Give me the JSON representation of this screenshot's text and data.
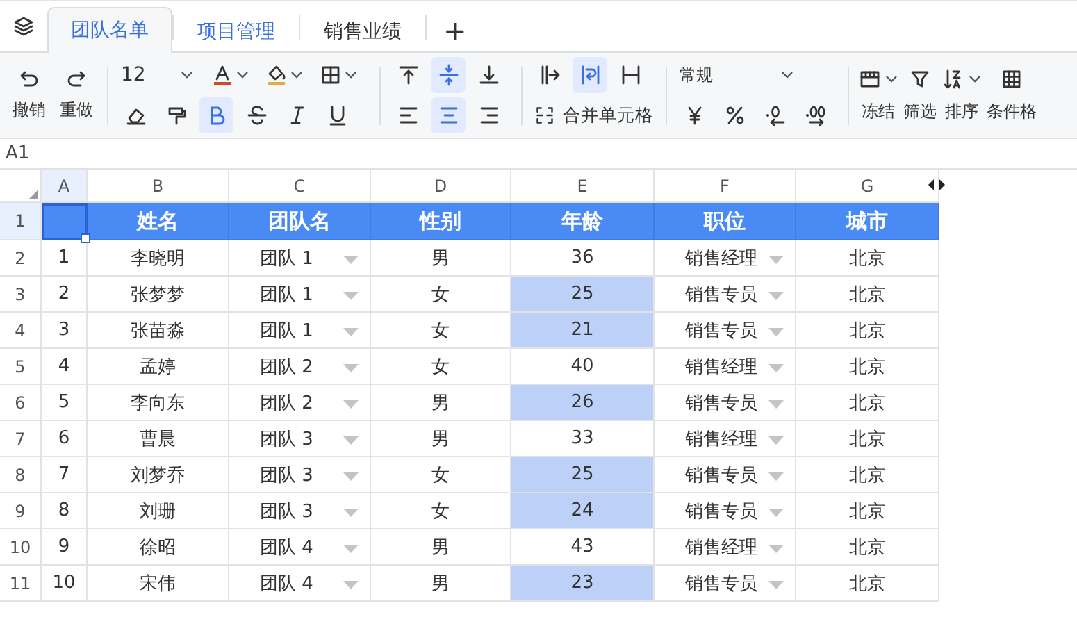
{
  "tabs": [
    {
      "label": "团队名单",
      "selected": true,
      "hovered": false
    },
    {
      "label": "项目管理",
      "selected": false,
      "hovered": true
    },
    {
      "label": "销售业绩",
      "selected": false,
      "hovered": false
    }
  ],
  "add_tab": "+",
  "toolbar": {
    "undo": "撤销",
    "redo": "重做",
    "font_size": "12",
    "number_format": "常规",
    "merge": "合并单元格",
    "buttons": [
      {
        "kind": "font-color",
        "active": false
      },
      {
        "kind": "fill-color",
        "active": false
      },
      {
        "kind": "border",
        "active": false
      },
      {
        "kind": "eraser",
        "active": false
      },
      {
        "kind": "painter",
        "active": false
      },
      {
        "kind": "bold",
        "active": true
      },
      {
        "kind": "strike",
        "active": false
      },
      {
        "kind": "italic",
        "active": false
      },
      {
        "kind": "underline",
        "active": false
      },
      {
        "kind": "align-top",
        "active": false
      },
      {
        "kind": "align-middle",
        "active": true
      },
      {
        "kind": "align-bottom",
        "active": false
      },
      {
        "kind": "align-left",
        "active": false
      },
      {
        "kind": "align-center",
        "active": true
      },
      {
        "kind": "align-right",
        "active": false
      },
      {
        "kind": "overflow",
        "active": false
      },
      {
        "kind": "wrap",
        "active": true
      },
      {
        "kind": "clip",
        "active": false
      },
      {
        "kind": "currency",
        "active": false
      },
      {
        "kind": "percent",
        "active": false
      },
      {
        "kind": "decimal-decrease",
        "active": false
      },
      {
        "kind": "decimal-increase",
        "active": false
      }
    ],
    "actions": [
      {
        "kind": "freeze",
        "label": "冻结"
      },
      {
        "kind": "filter",
        "label": "筛选"
      },
      {
        "kind": "sort",
        "label": "排序"
      },
      {
        "kind": "conditional",
        "label": "条件格"
      }
    ]
  },
  "name_box": "A1",
  "sheet": {
    "columns": [
      {
        "label": "A",
        "selected": true
      },
      {
        "label": "B",
        "selected": false
      },
      {
        "label": "C",
        "selected": false
      },
      {
        "label": "D",
        "selected": false
      },
      {
        "label": "E",
        "selected": false
      },
      {
        "label": "F",
        "selected": false
      },
      {
        "label": "G",
        "selected": false
      }
    ],
    "rows": [
      {
        "number": "1",
        "selected": true,
        "kind": "header",
        "cells": [
          {},
          {
            "text": "姓名"
          },
          {
            "text": "团队名"
          },
          {
            "text": "性别"
          },
          {
            "text": "年龄"
          },
          {
            "text": "职位"
          },
          {
            "text": "城市"
          }
        ]
      },
      {
        "number": "2",
        "selected": false,
        "kind": "data",
        "cells": [
          {
            "text": "1"
          },
          {
            "text": "李晓明"
          },
          {
            "text": "团队 1",
            "dropdown": true
          },
          {
            "text": "男"
          },
          {
            "text": "36",
            "highlighted": false
          },
          {
            "text": "销售经理",
            "dropdown": true
          },
          {
            "text": "北京"
          }
        ]
      },
      {
        "number": "3",
        "selected": false,
        "kind": "data",
        "cells": [
          {
            "text": "2"
          },
          {
            "text": "张梦梦"
          },
          {
            "text": "团队 1",
            "dropdown": true
          },
          {
            "text": "女"
          },
          {
            "text": "25",
            "highlighted": true
          },
          {
            "text": "销售专员",
            "dropdown": true
          },
          {
            "text": "北京"
          }
        ]
      },
      {
        "number": "4",
        "selected": false,
        "kind": "data",
        "cells": [
          {
            "text": "3"
          },
          {
            "text": "张苗淼"
          },
          {
            "text": "团队 1",
            "dropdown": true
          },
          {
            "text": "女"
          },
          {
            "text": "21",
            "highlighted": true
          },
          {
            "text": "销售专员",
            "dropdown": true
          },
          {
            "text": "北京"
          }
        ]
      },
      {
        "number": "5",
        "selected": false,
        "kind": "data",
        "cells": [
          {
            "text": "4"
          },
          {
            "text": "孟婷"
          },
          {
            "text": "团队 2",
            "dropdown": true
          },
          {
            "text": "女"
          },
          {
            "text": "40",
            "highlighted": false
          },
          {
            "text": "销售经理",
            "dropdown": true
          },
          {
            "text": "北京"
          }
        ]
      },
      {
        "number": "6",
        "selected": false,
        "kind": "data",
        "cells": [
          {
            "text": "5"
          },
          {
            "text": "李向东"
          },
          {
            "text": "团队 2",
            "dropdown": true
          },
          {
            "text": "男"
          },
          {
            "text": "26",
            "highlighted": true
          },
          {
            "text": "销售专员",
            "dropdown": true
          },
          {
            "text": "北京"
          }
        ]
      },
      {
        "number": "7",
        "selected": false,
        "kind": "data",
        "cells": [
          {
            "text": "6"
          },
          {
            "text": "曹晨"
          },
          {
            "text": "团队 3",
            "dropdown": true
          },
          {
            "text": "男"
          },
          {
            "text": "33",
            "highlighted": false
          },
          {
            "text": "销售经理",
            "dropdown": true
          },
          {
            "text": "北京"
          }
        ]
      },
      {
        "number": "8",
        "selected": false,
        "kind": "data",
        "cells": [
          {
            "text": "7"
          },
          {
            "text": "刘梦乔"
          },
          {
            "text": "团队 3",
            "dropdown": true
          },
          {
            "text": "女"
          },
          {
            "text": "25",
            "highlighted": true
          },
          {
            "text": "销售专员",
            "dropdown": true
          },
          {
            "text": "北京"
          }
        ]
      },
      {
        "number": "9",
        "selected": false,
        "kind": "data",
        "cells": [
          {
            "text": "8"
          },
          {
            "text": "刘珊"
          },
          {
            "text": "团队 3",
            "dropdown": true
          },
          {
            "text": "女"
          },
          {
            "text": "24",
            "highlighted": true
          },
          {
            "text": "销售专员",
            "dropdown": true
          },
          {
            "text": "北京"
          }
        ]
      },
      {
        "number": "10",
        "selected": false,
        "kind": "data",
        "cells": [
          {
            "text": "9"
          },
          {
            "text": "徐昭"
          },
          {
            "text": "团队 4",
            "dropdown": true
          },
          {
            "text": "男"
          },
          {
            "text": "43",
            "highlighted": false
          },
          {
            "text": "销售经理",
            "dropdown": true
          },
          {
            "text": "北京"
          }
        ]
      },
      {
        "number": "11",
        "selected": false,
        "kind": "data",
        "cells": [
          {
            "text": "10"
          },
          {
            "text": "宋伟"
          },
          {
            "text": "团队 4",
            "dropdown": true
          },
          {
            "text": "男"
          },
          {
            "text": "23",
            "highlighted": true
          },
          {
            "text": "销售专员",
            "dropdown": true
          },
          {
            "text": "北京"
          }
        ]
      }
    ]
  }
}
